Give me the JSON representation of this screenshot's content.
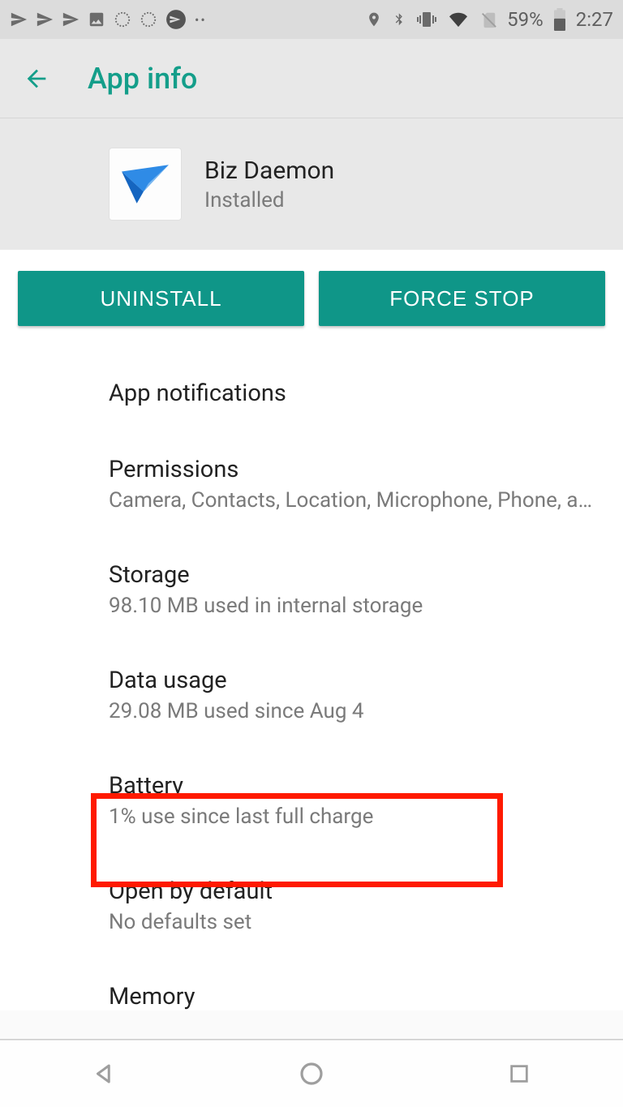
{
  "status": {
    "battery_pct": "59%",
    "clock": "2:27",
    "icons": [
      "send",
      "send",
      "send",
      "image",
      "circle",
      "circle",
      "send-circle",
      "more",
      "location",
      "bluetooth",
      "vibrate",
      "wifi",
      "no-sim",
      "battery"
    ]
  },
  "appbar": {
    "title": "App info"
  },
  "app": {
    "name": "Biz Daemon",
    "state": "Installed"
  },
  "buttons": {
    "uninstall": "UNINSTALL",
    "force_stop": "FORCE STOP"
  },
  "rows": {
    "notifications": {
      "title": "App notifications"
    },
    "permissions": {
      "title": "Permissions",
      "sub": "Camera, Contacts, Location, Microphone, Phone, a…"
    },
    "storage": {
      "title": "Storage",
      "sub": "98.10 MB used in internal storage"
    },
    "data_usage": {
      "title": "Data usage",
      "sub": "29.08 MB used since Aug 4"
    },
    "battery": {
      "title": "Battery",
      "sub": "1% use since last full charge"
    },
    "open_default": {
      "title": "Open by default",
      "sub": "No defaults set"
    },
    "memory": {
      "title": "Memory"
    }
  },
  "highlight": "battery"
}
